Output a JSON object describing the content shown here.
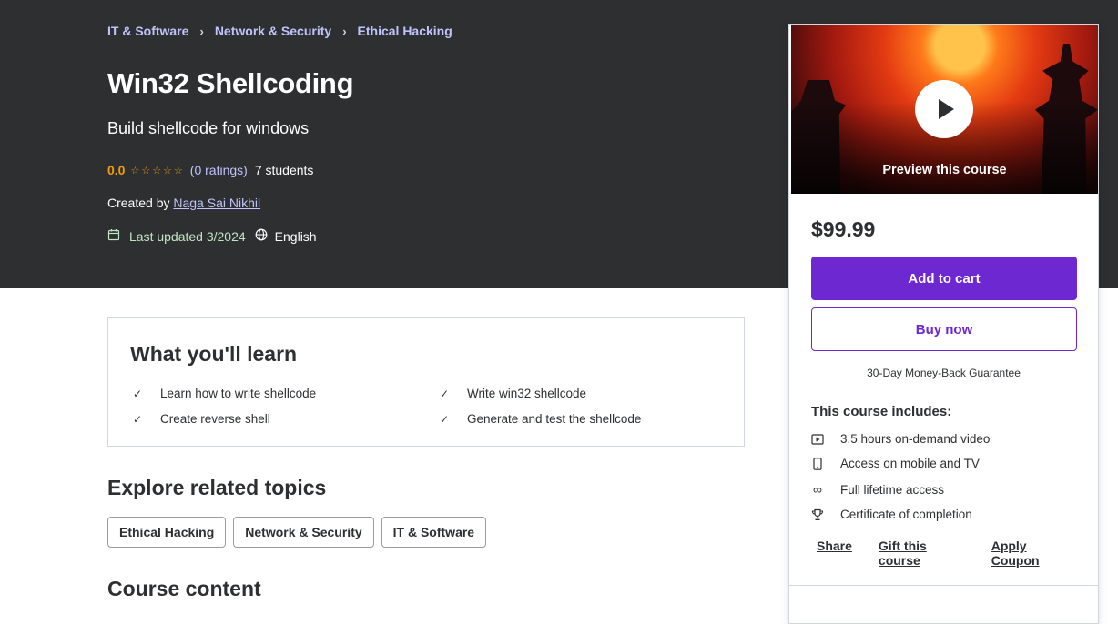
{
  "breadcrumb": [
    "IT & Software",
    "Network & Security",
    "Ethical Hacking"
  ],
  "course": {
    "title": "Win32 Shellcoding",
    "subtitle": "Build shellcode for windows",
    "rating": "0.0",
    "ratings_link": "(0 ratings)",
    "students": "7 students",
    "created_by_prefix": "Created by",
    "instructor": "Naga Sai Nikhil",
    "last_updated": "Last updated 3/2024",
    "language": "English"
  },
  "learn": {
    "heading": "What you'll learn",
    "items": [
      "Learn how to write shellcode",
      "Write win32 shellcode",
      "Create reverse shell",
      "Generate and test the shellcode"
    ]
  },
  "related": {
    "heading": "Explore related topics",
    "topics": [
      "Ethical Hacking",
      "Network & Security",
      "IT & Software"
    ]
  },
  "course_content_heading": "Course content",
  "sidebar": {
    "preview_label": "Preview this course",
    "price": "$99.99",
    "add_to_cart": "Add to cart",
    "buy_now": "Buy now",
    "guarantee": "30-Day Money-Back Guarantee",
    "includes_heading": "This course includes:",
    "includes": [
      {
        "icon": "video-icon",
        "text": "3.5 hours on-demand video"
      },
      {
        "icon": "mobile-icon",
        "text": "Access on mobile and TV"
      },
      {
        "icon": "infinity-icon",
        "text": "Full lifetime access"
      },
      {
        "icon": "trophy-icon",
        "text": "Certificate of completion"
      }
    ],
    "share": "Share",
    "gift": "Gift this course",
    "coupon": "Apply Coupon"
  },
  "colors": {
    "hero_bg": "#2d2f31",
    "brand_purple": "#6d28d2",
    "link_lavender": "#c0c4fc",
    "rating_orange": "#f69c08",
    "updated_green": "#c1e6c3"
  }
}
